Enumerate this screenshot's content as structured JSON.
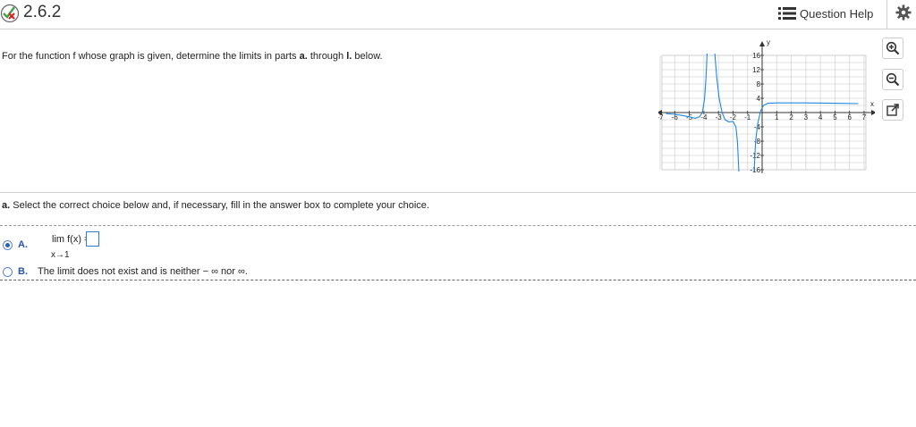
{
  "header": {
    "question_number": "2.6.2",
    "status_icon": "partial-correct-icon",
    "help_label": "Question Help",
    "help_icon": "list-icon",
    "settings_icon": "gear-icon"
  },
  "instruction": {
    "prefix": "For the function f whose graph is given, determine the limits in parts ",
    "a": "a.",
    "middle": " through ",
    "l": "l.",
    "suffix": " below."
  },
  "graph": {
    "x_axis_label": "x",
    "y_axis_label": "y",
    "x_ticks": [
      "-7",
      "-6",
      "-5",
      "-4",
      "-3",
      "-2",
      "-1",
      "1",
      "2",
      "3",
      "4",
      "5",
      "6",
      "7"
    ],
    "y_ticks": [
      "16",
      "12",
      "8",
      "4",
      "-4",
      "-8",
      "-12",
      "-16"
    ],
    "x_range": [
      -7,
      7
    ],
    "y_range": [
      -16,
      16
    ],
    "curve_color": "#1e88e5",
    "tools": [
      "zoom-in-icon",
      "zoom-out-icon",
      "popout-icon"
    ]
  },
  "part_a": {
    "label": "a.",
    "prompt": " Select the correct choice below and, if necessary, fill in the answer box to complete your choice.",
    "option_a": {
      "letter": "A.",
      "lim_text": "lim f(x) =",
      "lim_sub": "x→1",
      "answer_value": "",
      "selected": true
    },
    "option_b": {
      "letter": "B.",
      "text": "The limit does not exist and is neither  − ∞ nor ∞.",
      "selected": false
    }
  },
  "colors": {
    "accent": "#2a55a6",
    "curve": "#1e88e5",
    "border": "#d0d0d0"
  }
}
